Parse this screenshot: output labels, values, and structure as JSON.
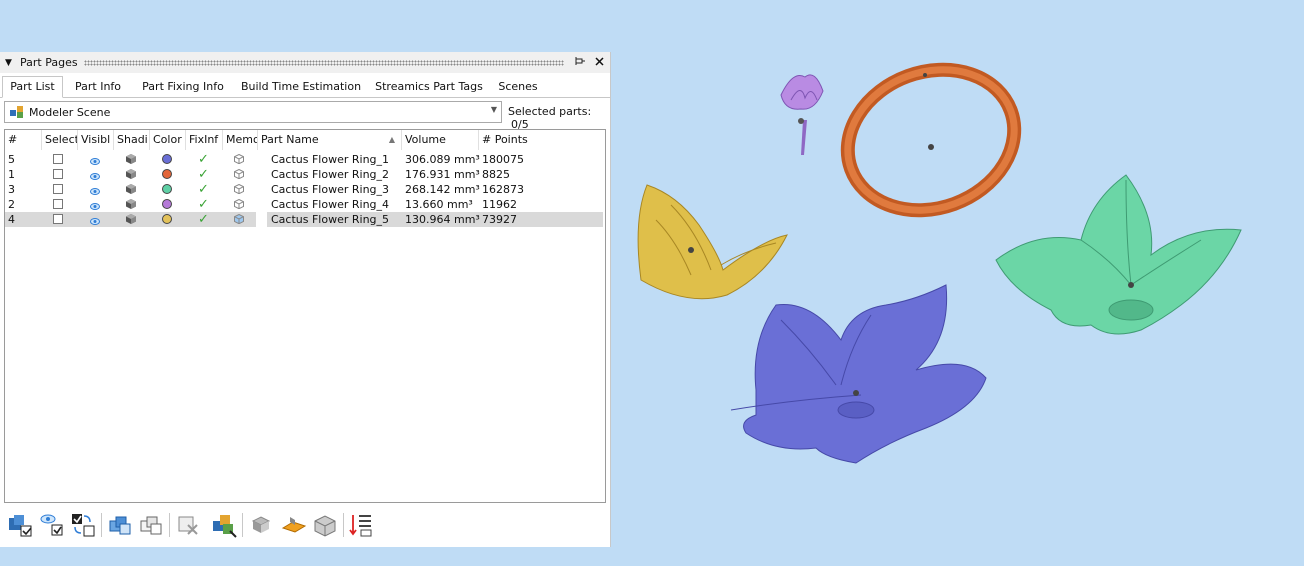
{
  "panel": {
    "title": "Part Pages",
    "pin_label": "⊟",
    "close_label": "✕"
  },
  "tabs": [
    {
      "label": "Part List",
      "active": true
    },
    {
      "label": "Part Info",
      "active": false
    },
    {
      "label": "Part Fixing Info",
      "active": false
    },
    {
      "label": "Build Time Estimation",
      "active": false
    },
    {
      "label": "Streamics Part Tags",
      "active": false
    },
    {
      "label": "Scenes",
      "active": false
    }
  ],
  "scene": {
    "value": "Modeler Scene",
    "selected_label": "Selected parts:",
    "selected_count": "0/5"
  },
  "table": {
    "columns": [
      "#",
      "Selecte",
      "Visibl",
      "Shadi",
      "Color",
      "FixInf",
      "Memo",
      "Part Name",
      "Volume",
      "# Points"
    ],
    "rows": [
      {
        "num": "5",
        "name": "Cactus Flower Ring_1",
        "volume": "306.089 mm³",
        "points": "180075",
        "color": "#6a6fd6",
        "selected": false
      },
      {
        "num": "1",
        "name": "Cactus Flower Ring_2",
        "volume": "176.931 mm³",
        "points": "8825",
        "color": "#e3663a",
        "selected": false
      },
      {
        "num": "3",
        "name": "Cactus Flower Ring_3",
        "volume": "268.142 mm³",
        "points": "162873",
        "color": "#5fd0a5",
        "selected": false
      },
      {
        "num": "2",
        "name": "Cactus Flower Ring_4",
        "volume": "13.660 mm³",
        "points": "11962",
        "color": "#b57ad8",
        "selected": false
      },
      {
        "num": "4",
        "name": "Cactus Flower Ring_5",
        "volume": "130.964 mm³",
        "points": "73927",
        "color": "#e3c25a",
        "selected": true
      }
    ]
  },
  "toolbar_icons": [
    "select-all-icon",
    "show-visible-icon",
    "invert-selection-icon",
    "group-parts-icon",
    "ungroup-parts-icon",
    "deselect-part-icon",
    "scene-parts-icon",
    "unload-part-icon",
    "platform-icon",
    "part-box-icon",
    "sort-list-icon"
  ],
  "viewport": {
    "background": "#bfdcf5",
    "objects": [
      {
        "name": "Cactus Flower Ring_1",
        "color": "#6a6fd6"
      },
      {
        "name": "Cactus Flower Ring_2",
        "color": "#d9682e"
      },
      {
        "name": "Cactus Flower Ring_3",
        "color": "#6bd6a6"
      },
      {
        "name": "Cactus Flower Ring_4",
        "color": "#a877d6"
      },
      {
        "name": "Cactus Flower Ring_5",
        "color": "#dfbf4a"
      }
    ]
  }
}
